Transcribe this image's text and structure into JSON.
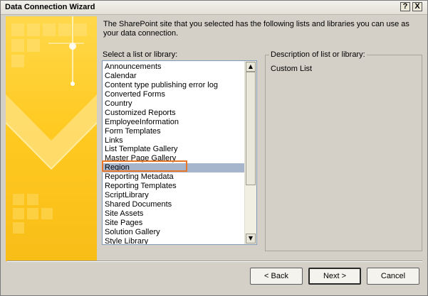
{
  "window": {
    "title": "Data Connection Wizard",
    "help_label": "?",
    "close_label": "X"
  },
  "intro_text": "The SharePoint site that you selected has the following lists and libraries you can use as your data connection.",
  "list": {
    "label": "Select a list or library:",
    "items": [
      "Announcements",
      "Calendar",
      "Content type publishing error log",
      "Converted Forms",
      "Country",
      "Customized Reports",
      "EmployeeInformation",
      "Form Templates",
      "Links",
      "List Template Gallery",
      "Master Page Gallery",
      "Region",
      "Reporting Metadata",
      "Reporting Templates",
      "ScriptLibrary",
      "Shared Documents",
      "Site Assets",
      "Site Pages",
      "Solution Gallery",
      "Style Library"
    ],
    "selected": "Region",
    "scroll_up_icon": "scroll-up-arrow-icon",
    "scroll_down_icon": "scroll-down-arrow-icon"
  },
  "description": {
    "label": "Description of list or library:",
    "value": "Custom List"
  },
  "buttons": {
    "back": "< Back",
    "next": "Next >",
    "cancel": "Cancel"
  },
  "colors": {
    "selection": "#a6b4cc",
    "highlight_box": "#e8772a",
    "banner": "#ffca22"
  }
}
